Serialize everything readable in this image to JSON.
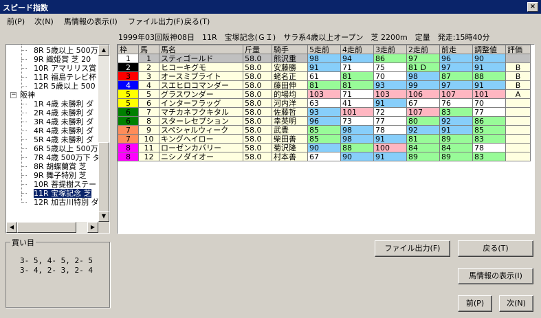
{
  "window": {
    "title": "スピード指数",
    "close_label": "×"
  },
  "menu": [
    "前(P)",
    "次(N)",
    "馬情報の表示(I)",
    "ファイル出力(F)",
    "戻る(T)"
  ],
  "race_info": "1999年03回阪神08日　11R　宝塚記念(ＧＩ)　サラ系4歳以上オープン　芝 2200m　定量　発走:15時40分",
  "tree": {
    "top_items": [
      "8R 5歳以上 500万",
      "9R 織姫賞 芝 20",
      "10R アマリリス賞",
      "11R 福島テレビ杯",
      "12R 5歳以上 500"
    ],
    "group_expander": "−",
    "group_label": "阪神",
    "hanshin_items": [
      "1R 4歳 未勝利 ダ",
      "2R 4歳 未勝利 ダ",
      "3R 4歳 未勝利 ダ",
      "4R 4歳 未勝利 ダ",
      "5R 4歳 未勝利 ダ",
      "6R 5歳以上 500万",
      "7R 4歳 500万下 ダ",
      "8R 胡蝶蘭賞 芝",
      "9R 舞子特別 芝",
      "10R 菩提樹ステー",
      "11R 宝塚記念 芝",
      "12R 加古川特別 ダ"
    ],
    "selected_index": 10
  },
  "grid": {
    "headers": [
      "枠",
      "馬",
      "馬名",
      "斤量",
      "騎手",
      "5走前",
      "4走前",
      "3走前",
      "2走前",
      "前走",
      "調整値",
      "評価"
    ],
    "rows": [
      {
        "waku": "1",
        "wcolor": "#ffffff",
        "wtext": "#000000",
        "uma": "1",
        "name": "スティゴールド",
        "kin": "58.0",
        "jockey": "熊沢重",
        "r5": "98",
        "c5": "blue",
        "r4": "94",
        "c4": "blue",
        "r3": "86",
        "c3": "green",
        "r2": "97",
        "c2": "green",
        "r1": "96",
        "c1": "blue",
        "adj": "90",
        "ca": "blue",
        "ev": "",
        "selected": true
      },
      {
        "waku": "2",
        "wcolor": "#000000",
        "wtext": "#ffffff",
        "uma": "2",
        "name": "ヒコーキグモ",
        "kin": "58.0",
        "jockey": "安藤勝",
        "r5": "91",
        "c5": "blue",
        "r4": "71",
        "c4": "",
        "r3": "75",
        "c3": "",
        "r2": "81 D",
        "c2": "green",
        "r1": "97",
        "c1": "blue",
        "adj": "91",
        "ca": "blue",
        "ev": "B"
      },
      {
        "waku": "3",
        "wcolor": "#ff0000",
        "wtext": "#000000",
        "uma": "3",
        "name": "オースミブライト",
        "kin": "58.0",
        "jockey": "蛯名正",
        "r5": "61",
        "c5": "",
        "r4": "81",
        "c4": "green",
        "r3": "70",
        "c3": "",
        "r2": "98",
        "c2": "blue",
        "r1": "87",
        "c1": "green",
        "adj": "88",
        "ca": "green",
        "ev": "B"
      },
      {
        "waku": "4",
        "wcolor": "#0000ff",
        "wtext": "#ffffff",
        "uma": "4",
        "name": "スエヒロコマンダー",
        "kin": "58.0",
        "jockey": "藤田伸",
        "r5": "81",
        "c5": "green",
        "r4": "81",
        "c4": "green",
        "r3": "93",
        "c3": "blue",
        "r2": "99",
        "c2": "blue",
        "r1": "97",
        "c1": "blue",
        "adj": "91",
        "ca": "blue",
        "ev": "B"
      },
      {
        "waku": "5",
        "wcolor": "#ffff00",
        "wtext": "#000000",
        "uma": "5",
        "name": "グラスワンダー",
        "kin": "58.0",
        "jockey": "的場均",
        "r5": "103",
        "c5": "pink",
        "r4": "71",
        "c4": "",
        "r3": "103",
        "c3": "pink",
        "r2": "106",
        "c2": "pink",
        "r1": "107",
        "c1": "pink",
        "adj": "101",
        "ca": "pink",
        "ev": "A"
      },
      {
        "waku": "5",
        "wcolor": "#ffff00",
        "wtext": "#000000",
        "uma": "6",
        "name": "インターフラッグ",
        "kin": "58.0",
        "jockey": "河内洋",
        "r5": "63",
        "c5": "",
        "r4": "41",
        "c4": "",
        "r3": "91",
        "c3": "blue",
        "r2": "67",
        "c2": "",
        "r1": "76",
        "c1": "",
        "adj": "70",
        "ca": "",
        "ev": ""
      },
      {
        "waku": "6",
        "wcolor": "#008000",
        "wtext": "#000000",
        "uma": "7",
        "name": "マチカネフクキタル",
        "kin": "58.0",
        "jockey": "佐藤哲",
        "r5": "93",
        "c5": "blue",
        "r4": "101",
        "c4": "pink",
        "r3": "72",
        "c3": "",
        "r2": "107",
        "c2": "pink",
        "r1": "83",
        "c1": "green",
        "adj": "77",
        "ca": "",
        "ev": ""
      },
      {
        "waku": "6",
        "wcolor": "#008000",
        "wtext": "#000000",
        "uma": "8",
        "name": "スターレセプション",
        "kin": "58.0",
        "jockey": "幸英明",
        "r5": "96",
        "c5": "blue",
        "r4": "73",
        "c4": "",
        "r3": "77",
        "c3": "",
        "r2": "80",
        "c2": "green",
        "r1": "92",
        "c1": "blue",
        "adj": "86",
        "ca": "green",
        "ev": ""
      },
      {
        "waku": "7",
        "wcolor": "#ff8c5a",
        "wtext": "#000000",
        "uma": "9",
        "name": "スペシャルウィーク",
        "kin": "58.0",
        "jockey": "武豊",
        "r5": "85",
        "c5": "green",
        "r4": "98",
        "c4": "blue",
        "r3": "78",
        "c3": "",
        "r2": "92",
        "c2": "blue",
        "r1": "91",
        "c1": "blue",
        "adj": "85",
        "ca": "green",
        "ev": ""
      },
      {
        "waku": "7",
        "wcolor": "#ff8c5a",
        "wtext": "#000000",
        "uma": "10",
        "name": "キングヘイロー",
        "kin": "58.0",
        "jockey": "柴田善",
        "r5": "85",
        "c5": "green",
        "r4": "98",
        "c4": "blue",
        "r3": "91",
        "c3": "blue",
        "r2": "81",
        "c2": "green",
        "r1": "89",
        "c1": "green",
        "adj": "83",
        "ca": "green",
        "ev": ""
      },
      {
        "waku": "8",
        "wcolor": "#ff00ff",
        "wtext": "#000000",
        "uma": "11",
        "name": "ローゼンカバリー",
        "kin": "58.0",
        "jockey": "菊沢隆",
        "r5": "90",
        "c5": "blue",
        "r4": "88",
        "c4": "green",
        "r3": "100",
        "c3": "pink",
        "r2": "84",
        "c2": "green",
        "r1": "84",
        "c1": "green",
        "adj": "78",
        "ca": "",
        "ev": ""
      },
      {
        "waku": "8",
        "wcolor": "#ff00ff",
        "wtext": "#000000",
        "uma": "12",
        "name": "ニシノダイオー",
        "kin": "58.0",
        "jockey": "村本善",
        "r5": "67",
        "c5": "",
        "r4": "90",
        "c4": "blue",
        "r3": "91",
        "c3": "blue",
        "r2": "89",
        "c2": "green",
        "r1": "89",
        "c1": "green",
        "adj": "83",
        "ca": "green",
        "ev": ""
      }
    ]
  },
  "kaime": {
    "label": "買い目",
    "lines": [
      "3- 5, 4- 5, 2- 5",
      "3- 4, 2- 3, 2- 4"
    ]
  },
  "buttons": {
    "file_output": "ファイル出力(F)",
    "back": "戻る(T)",
    "horse_info": "馬情報の表示(I)",
    "prev": "前(P)",
    "next": "次(N)"
  },
  "scroll_arrows": {
    "up": "▲",
    "down": "▼",
    "left": "◀",
    "right": "▶"
  }
}
